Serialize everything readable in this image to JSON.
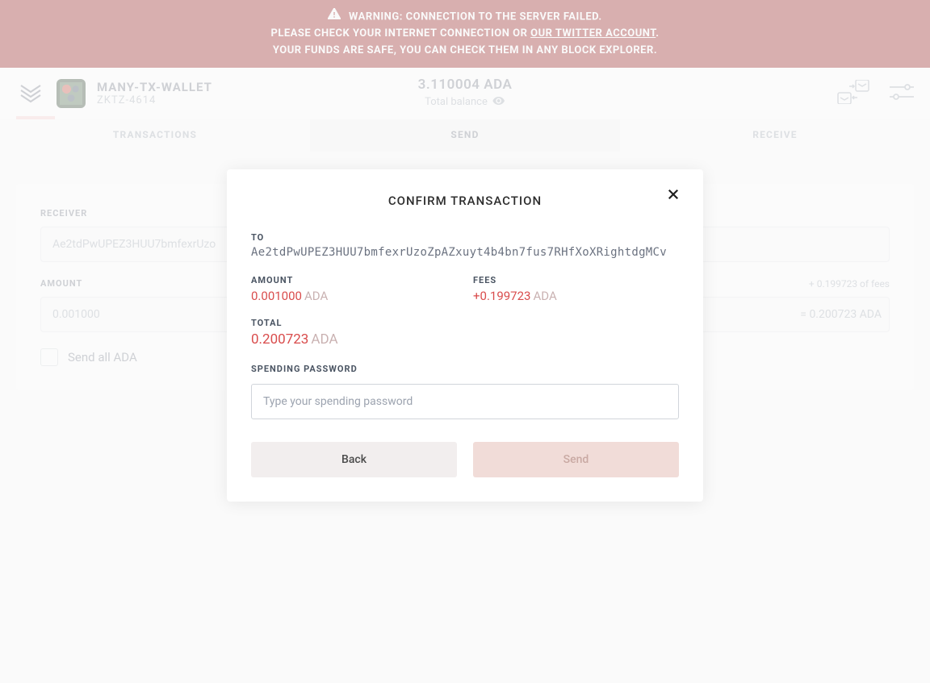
{
  "warning": {
    "line1": "WARNING: CONNECTION TO THE SERVER FAILED.",
    "line2_prefix": "PLEASE CHECK YOUR INTERNET CONNECTION OR ",
    "line2_link": "OUR TWITTER ACCOUNT",
    "line2_suffix": ".",
    "line3": "YOUR FUNDS ARE SAFE, YOU CAN CHECK THEM IN ANY BLOCK EXPLORER."
  },
  "header": {
    "wallet_name": "MANY-TX-WALLET",
    "wallet_subtitle": "ZKTZ-4614",
    "balance": "3.110004 ADA",
    "balance_label": "Total balance"
  },
  "tabs": {
    "transactions": "TRANSACTIONS",
    "send": "SEND",
    "receive": "RECEIVE"
  },
  "form": {
    "receiver_label": "RECEIVER",
    "receiver_value": "Ae2tdPwUPEZ3HUU7bmfexrUzo",
    "amount_label": "AMOUNT",
    "amount_value": "0.001000",
    "fees_hint": "+ 0.199723 of fees",
    "equals": "= 0.200723 ADA",
    "send_all_label": "Send all ADA"
  },
  "modal": {
    "title": "CONFIRM TRANSACTION",
    "to_label": "TO",
    "to_value": "Ae2tdPwUPEZ3HUU7bmfexrUzoZpAZxuyt4b4bn7fus7RHfXoXRightdgMCv",
    "amount_label": "AMOUNT",
    "amount_num": "0.001000",
    "amount_cur": "ADA",
    "fees_label": "FEES",
    "fees_num": "+0.199723",
    "fees_cur": "ADA",
    "total_label": "TOTAL",
    "total_num": "0.200723",
    "total_cur": "ADA",
    "password_label": "SPENDING PASSWORD",
    "password_placeholder": "Type your spending password",
    "back_label": "Back",
    "send_label": "Send"
  }
}
